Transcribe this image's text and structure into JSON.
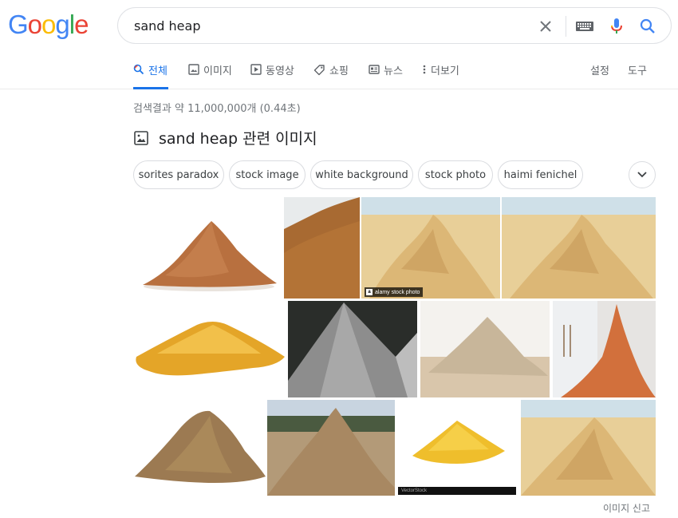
{
  "logo": {
    "letters": [
      "G",
      "o",
      "o",
      "g",
      "l",
      "e"
    ],
    "colors": [
      "#4285F4",
      "#EA4335",
      "#FBBC05",
      "#4285F4",
      "#34A853",
      "#EA4335"
    ]
  },
  "search": {
    "query": "sand heap",
    "clear_icon": "close-icon",
    "keyboard_icon": "keyboard-icon",
    "voice_icon": "mic-icon",
    "search_icon": "search-icon"
  },
  "tabs": [
    {
      "label": "전체",
      "icon": "search-icon",
      "active": true
    },
    {
      "label": "이미지",
      "icon": "image-icon"
    },
    {
      "label": "동영상",
      "icon": "video-icon"
    },
    {
      "label": "쇼핑",
      "icon": "tag-icon"
    },
    {
      "label": "뉴스",
      "icon": "news-icon"
    },
    {
      "label": "더보기",
      "icon": "more-vert-icon"
    }
  ],
  "tools": {
    "settings": "설정",
    "tools": "도구"
  },
  "result_stats": "검색결과 약 11,000,000개 (0.44초)",
  "images_section": {
    "title": "sand heap 관련 이미지",
    "chips": [
      "sorites paradox",
      "stock image",
      "white background",
      "stock photo",
      "haimi fenichel"
    ],
    "watermark_1": "alamy stock photo",
    "watermark_2": "VectorStock",
    "report": "이미지 신고"
  },
  "colors": {
    "accent": "#1a73e8",
    "text_muted": "#70757a",
    "border": "#dfe1e5"
  }
}
